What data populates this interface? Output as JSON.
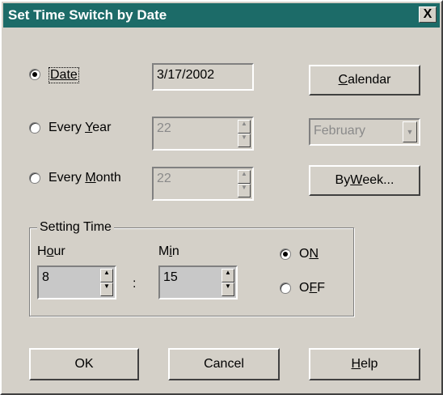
{
  "window": {
    "title": "Set Time Switch by Date",
    "close_glyph": "X"
  },
  "mode": {
    "selected": "date",
    "date": {
      "label": "Date",
      "value": "3/17/2002"
    },
    "every_year": {
      "label_pre": "Every ",
      "label_u": "Y",
      "label_post": "ear",
      "value": "22",
      "month": "February"
    },
    "every_month": {
      "label_pre": "Every ",
      "label_u": "M",
      "label_post": "onth",
      "value": "22"
    }
  },
  "buttons": {
    "calendar": {
      "u": "C",
      "rest": "alendar"
    },
    "by_week": {
      "pre": "By ",
      "u": "W",
      "rest": "eek..."
    },
    "ok": "OK",
    "cancel": "Cancel",
    "help": {
      "u": "H",
      "rest": "elp"
    }
  },
  "setting_time": {
    "group_label": "Setting Time",
    "hour_label": {
      "pre": "H",
      "u": "o",
      "rest": "ur"
    },
    "min_label": {
      "pre": "M",
      "u": "i",
      "rest": "n"
    },
    "hour_value": "8",
    "min_value": "15",
    "separator": ":",
    "on": {
      "pre": "O",
      "u": "N",
      "rest": ""
    },
    "off": {
      "pre": "O",
      "u": "F",
      "rest": "F"
    },
    "selected": "on"
  }
}
